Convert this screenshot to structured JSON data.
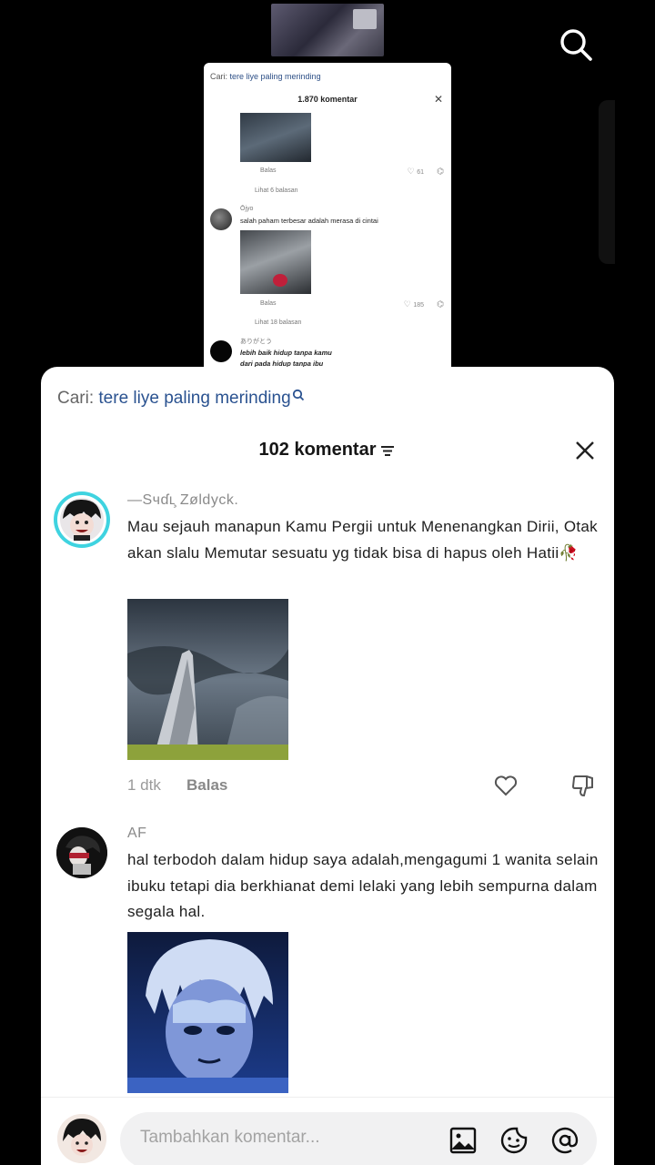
{
  "mini_panel": {
    "query_label": "Cari: ",
    "query": "tere liye paling merinding",
    "count": "1.870 komentar",
    "reply": "Balas",
    "likes_1": "61",
    "view_replies_1": "Lihat 6 balasan",
    "user_2": "Ōjyo",
    "text_2": "salah paham terbesar adalah merasa di cintai",
    "likes_2": "185",
    "view_replies_2": "Lihat 18 balasan",
    "user_3": "ありがとう",
    "text_3a": "lebih baik hidup tanpa kamu",
    "text_3b": "dari pada hidup tanpa ibu"
  },
  "search_hint": {
    "label": "Cari: ",
    "keyword": "tere liye paling merinding"
  },
  "header": {
    "count": "102 komentar"
  },
  "comments": [
    {
      "username": "—Sчɗʟ̧ Zøldyck.",
      "text": "Mau sejauh manapun Kamu Pergii untuk Menenangkan Dirii, Otak akan slalu Memutar sesuatu yg tidak bisa di hapus oleh Hatii🥀",
      "time": "1 dtk",
      "reply": "Balas"
    },
    {
      "username": "AF",
      "text": "hal terbodoh dalam hidup saya adalah,mengagumi 1 wanita selain ibuku tetapi dia berkhianat demi lelaki yang lebih sempurna dalam segala hal."
    }
  ],
  "composer": {
    "placeholder": "Tambahkan komentar..."
  },
  "icons": [
    "search-icon",
    "close-icon",
    "sort-icon",
    "heart-icon",
    "dislike-icon",
    "image-icon",
    "emoji-icon",
    "mention-icon"
  ],
  "colors": {
    "keyword": "#2a5290",
    "avatar_ring": "#3fd3e0"
  }
}
